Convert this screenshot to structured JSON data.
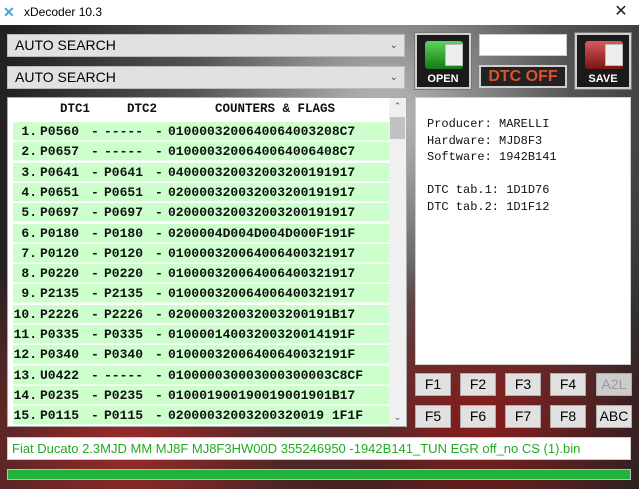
{
  "window": {
    "title": "xDecoder 10.3",
    "icon": "x-logo-icon",
    "close": "✕"
  },
  "search": {
    "combo1": "AUTO SEARCH",
    "combo2": "AUTO SEARCH"
  },
  "list": {
    "headers": {
      "dtc1": "DTC1",
      "dtc2": "DTC2",
      "counters": "COUNTERS & FLAGS"
    },
    "rows": [
      {
        "n": "1.",
        "dtc1": "P0560",
        "dtc2": "-----",
        "flags": "0100003200640064003208C7"
      },
      {
        "n": "2.",
        "dtc1": "P0657",
        "dtc2": "-----",
        "flags": "0100003200640064006408C7"
      },
      {
        "n": "3.",
        "dtc1": "P0641",
        "dtc2": "P0641",
        "flags": "040000320032003200191917"
      },
      {
        "n": "4.",
        "dtc1": "P0651",
        "dtc2": "P0651",
        "flags": "020000320032003200191917"
      },
      {
        "n": "5.",
        "dtc1": "P0697",
        "dtc2": "P0697",
        "flags": "020000320032003200191917"
      },
      {
        "n": "6.",
        "dtc1": "P0180",
        "dtc2": "P0180",
        "flags": "0200004D004D004D000F191F"
      },
      {
        "n": "7.",
        "dtc1": "P0120",
        "dtc2": "P0120",
        "flags": "010000320064006400321917"
      },
      {
        "n": "8.",
        "dtc1": "P0220",
        "dtc2": "P0220",
        "flags": "010000320064006400321917"
      },
      {
        "n": "9.",
        "dtc1": "P2135",
        "dtc2": "P2135",
        "flags": "010000320064006400321917"
      },
      {
        "n": "10.",
        "dtc1": "P2226",
        "dtc2": "P2226",
        "flags": "020000320032003200191B17"
      },
      {
        "n": "11.",
        "dtc1": "P0335",
        "dtc2": "P0335",
        "flags": "01000014003200320014191F"
      },
      {
        "n": "12.",
        "dtc1": "P0340",
        "dtc2": "P0340",
        "flags": "01000032006400640032191F"
      },
      {
        "n": "13.",
        "dtc1": "U0422",
        "dtc2": "-----",
        "flags": "010000030003000300003C8CF"
      },
      {
        "n": "14.",
        "dtc1": "P0235",
        "dtc2": "P0235",
        "flags": "010001900190019001901B17"
      },
      {
        "n": "15.",
        "dtc1": "P0115",
        "dtc2": "P0115",
        "flags": "02000032003200320019 1F1F"
      }
    ]
  },
  "buttons": {
    "open": "OPEN",
    "save": "SAVE",
    "dtc_off": "DTC OFF",
    "textbox": ""
  },
  "info": {
    "lines": [
      "Producer: MARELLI",
      "Hardware: MJD8F3",
      "Software: 1942B141",
      "",
      "DTC tab.1: 1D1D76",
      "DTC tab.2: 1D1F12"
    ]
  },
  "fkeys": [
    "F1",
    "F2",
    "F3",
    "F4",
    "A2L",
    "F5",
    "F6",
    "F7",
    "F8",
    "ABC"
  ],
  "filename": "Fiat Ducato 2.3MJD MM MJ8F MJ8F3HW00D 355246950 -1942B141_TUN EGR off_no CS (1).bin",
  "progress": 100
}
